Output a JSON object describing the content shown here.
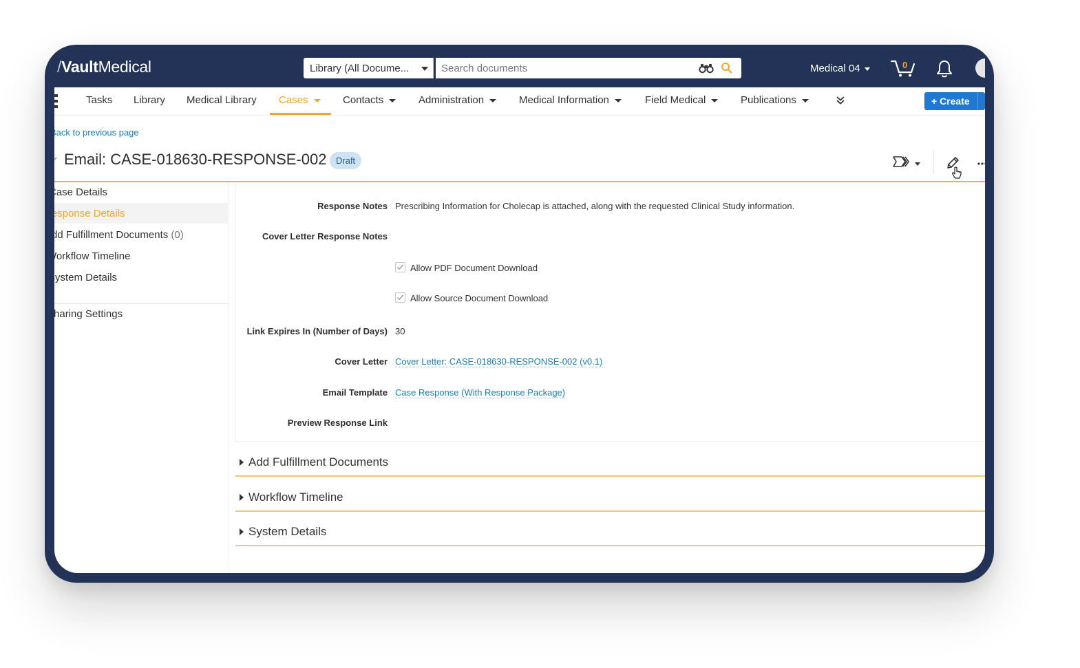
{
  "app": {
    "logo_slash": "/",
    "logo_bold": "Vault",
    "logo_light": "Medical"
  },
  "search": {
    "scope_label": "Library (All Docume...",
    "placeholder": "Search documents",
    "value": ""
  },
  "user": {
    "menu_label": "Medical 04"
  },
  "cart": {
    "count": "0"
  },
  "nav": {
    "items": [
      {
        "label": "Tasks"
      },
      {
        "label": "Library"
      },
      {
        "label": "Medical Library"
      },
      {
        "label": "Cases",
        "active": true
      },
      {
        "label": "Contacts"
      },
      {
        "label": "Administration"
      },
      {
        "label": "Medical Information"
      },
      {
        "label": "Field Medical"
      },
      {
        "label": "Publications"
      }
    ],
    "create_label": "+ Create"
  },
  "page": {
    "back_link": "Back to previous page",
    "title": "Email: CASE-018630-RESPONSE-002",
    "status_badge": "Draft"
  },
  "sidebar": {
    "items": [
      {
        "label": "Case Details"
      },
      {
        "label": "Response Details",
        "selected": true
      },
      {
        "label": "Add Fulfillment Documents",
        "count": "(0)"
      },
      {
        "label": "Workflow Timeline"
      },
      {
        "label": "System Details"
      },
      {
        "label": "Sharing Settings"
      }
    ]
  },
  "fields": {
    "response_notes": {
      "label": "Response Notes",
      "value": "Prescribing Information for Cholecap is attached, along with the requested Clinical Study information."
    },
    "cover_letter_notes": {
      "label": "Cover Letter Response Notes",
      "value": ""
    },
    "allow_pdf": {
      "label": "Allow PDF Document Download",
      "checked": true
    },
    "allow_source": {
      "label": "Allow Source Document Download",
      "checked": true
    },
    "link_expires": {
      "label": "Link Expires In (Number of Days)",
      "value": "30"
    },
    "cover_letter": {
      "label": "Cover Letter",
      "value": "Cover Letter: CASE-018630-RESPONSE-002 (v0.1)"
    },
    "email_template": {
      "label": "Email Template",
      "value": "Case Response (With Response Package)"
    },
    "preview_link": {
      "label": "Preview Response Link",
      "value": ""
    }
  },
  "sections": [
    {
      "title": "Add Fulfillment Documents"
    },
    {
      "title": "Workflow Timeline"
    },
    {
      "title": "System Details"
    }
  ],
  "colors": {
    "header_bg": "#223357",
    "accent_orange": "#f5a623",
    "link_blue": "#1a7fb8",
    "create_blue": "#1f78d1",
    "badge_bg": "#cde3f4"
  }
}
